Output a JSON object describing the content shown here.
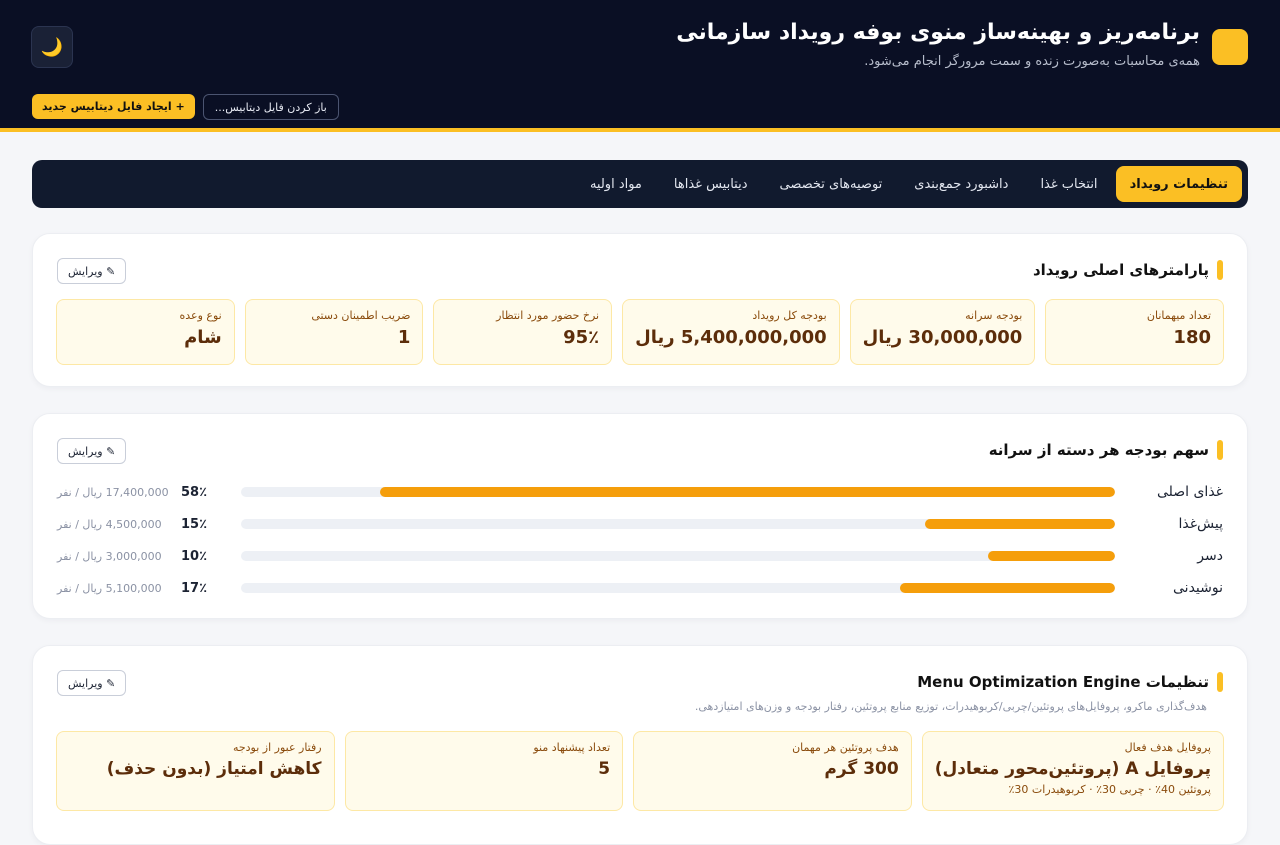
{
  "header": {
    "title": "برنامه‌ریز و بهینه‌ساز منوی بوفه رویداد سازمانی",
    "subtitle": "همه‌ی محاسبات به‌صورت زنده و سمت مرورگر انجام می‌شود.",
    "theme_icon": "🌙",
    "new_db_label": "+ ایجاد فایل دیتابیس جدید",
    "open_db_label": "باز کردن فایل دیتابیس..."
  },
  "tabs": [
    {
      "label": "تنظیمات رویداد",
      "active": true
    },
    {
      "label": "انتخاب غذا",
      "active": false
    },
    {
      "label": "داشبورد جمع‌بندی",
      "active": false
    },
    {
      "label": "توصیه‌های تخصصی",
      "active": false
    },
    {
      "label": "دیتابیس غذاها",
      "active": false
    },
    {
      "label": "مواد اولیه",
      "active": false
    }
  ],
  "edit_label": "✎ ویرایش",
  "params": {
    "title": "پارامترهای اصلی رویداد",
    "items": [
      {
        "label": "تعداد میهمانان",
        "value": "180"
      },
      {
        "label": "بودجه سرانه",
        "value": "30,000,000 ریال"
      },
      {
        "label": "بودجه کل رویداد",
        "value": "5,400,000,000 ریال"
      },
      {
        "label": "نرخ حضور مورد انتظار",
        "value": "95٪"
      },
      {
        "label": "ضریب اطمینان دستی",
        "value": "1"
      },
      {
        "label": "نوع وعده",
        "value": "شام"
      }
    ]
  },
  "shares": {
    "title": "سهم بودجه هر دسته از سرانه",
    "items": [
      {
        "name": "غذای اصلی",
        "percent": 58,
        "percent_label": "58٪",
        "amount": "17,400,000 ریال / نفر"
      },
      {
        "name": "پیش‌غذا",
        "percent": 15,
        "percent_label": "15٪",
        "amount": "4,500,000 ریال / نفر"
      },
      {
        "name": "دسر",
        "percent": 10,
        "percent_label": "10٪",
        "amount": "3,000,000 ریال / نفر"
      },
      {
        "name": "نوشیدنی",
        "percent": 17,
        "percent_label": "17٪",
        "amount": "5,100,000 ریال / نفر"
      }
    ]
  },
  "engine": {
    "title": "تنظیمات Menu Optimization Engine",
    "note": "هدف‌گذاری ماکرو، پروفایل‌های پروتئین/چربی/کربوهیدرات، توزیع منابع پروتئین، رفتار بودجه و وزن‌های امتیازدهی.",
    "items": [
      {
        "label": "پروفایل هدف فعال",
        "value": "پروفایل A (پروتئین‌محور متعادل)",
        "sub": "پروتئین 40٪ · چربی 30٪ · کربوهیدرات 30٪"
      },
      {
        "label": "هدف پروتئین هر مهمان",
        "value": "300 گرم",
        "sub": ""
      },
      {
        "label": "تعداد پیشنهاد منو",
        "value": "5",
        "sub": ""
      },
      {
        "label": "رفتار عبور از بودجه",
        "value": "کاهش امتیاز (بدون حذف)",
        "sub": ""
      }
    ]
  }
}
